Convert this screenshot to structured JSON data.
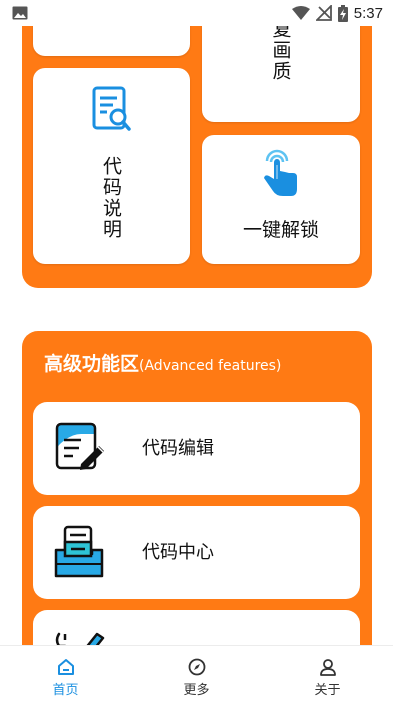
{
  "status_bar": {
    "time": "5:37"
  },
  "top_section": {
    "partial_card_label": "修复画质",
    "code_explain_label": "代码说明",
    "unlock_label": "一键解锁"
  },
  "advanced": {
    "title": "高级功能区",
    "subtitle": "(Advanced features)",
    "items": [
      {
        "label": "代码编辑",
        "icon": "code-edit-icon"
      },
      {
        "label": "代码中心",
        "icon": "code-center-icon"
      },
      {
        "label": "",
        "icon": "tools-icon"
      }
    ]
  },
  "bottom_nav": {
    "items": [
      {
        "label": "首页",
        "icon": "home-icon",
        "active": true
      },
      {
        "label": "更多",
        "icon": "compass-icon",
        "active": false
      },
      {
        "label": "关于",
        "icon": "person-icon",
        "active": false
      }
    ],
    "active_color": "#1a8fe0",
    "inactive_color": "#333333"
  },
  "colors": {
    "accent": "#ff7a14",
    "icon_blue": "#1a8fe0"
  }
}
